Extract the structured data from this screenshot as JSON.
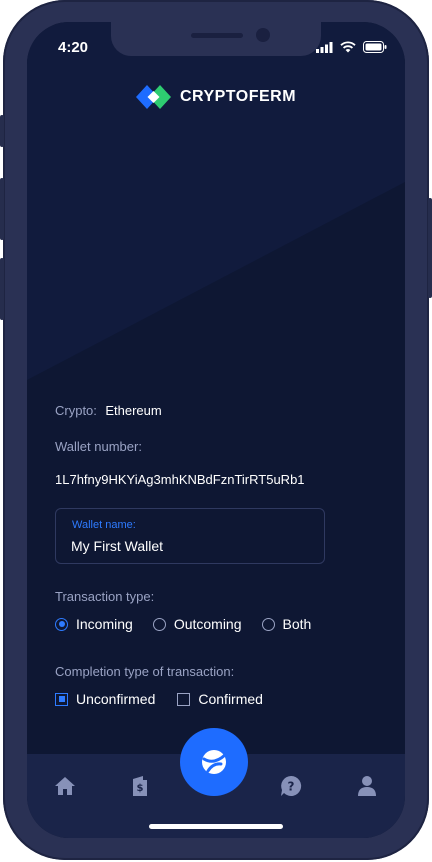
{
  "status_bar": {
    "time": "4:20"
  },
  "brand": {
    "name": "CRYPTOFERM"
  },
  "form": {
    "crypto_label": "Crypto:",
    "crypto_value": "Ethereum",
    "wallet_number_label": "Wallet number:",
    "wallet_number_value": "1L7hfny9HKYiAg3mhKNBdFznTirRT5uRb1",
    "wallet_name_label": "Wallet name:",
    "wallet_name_value": "My First Wallet",
    "transaction_type_label": "Transaction type:",
    "transaction_types": [
      {
        "label": "Incoming",
        "selected": true
      },
      {
        "label": "Outcoming",
        "selected": false
      },
      {
        "label": "Both",
        "selected": false
      }
    ],
    "completion_type_label": "Completion type of transaction:",
    "completion_types": [
      {
        "label": "Unconfirmed",
        "checked": true
      },
      {
        "label": "Confirmed",
        "checked": false
      }
    ]
  },
  "nav": {
    "items": [
      "home-icon",
      "wallet-icon",
      "exchange-icon",
      "help-icon",
      "profile-icon"
    ]
  },
  "colors": {
    "accent": "#1e6cff",
    "background": "#0e1733",
    "nav": "#1a2449"
  }
}
